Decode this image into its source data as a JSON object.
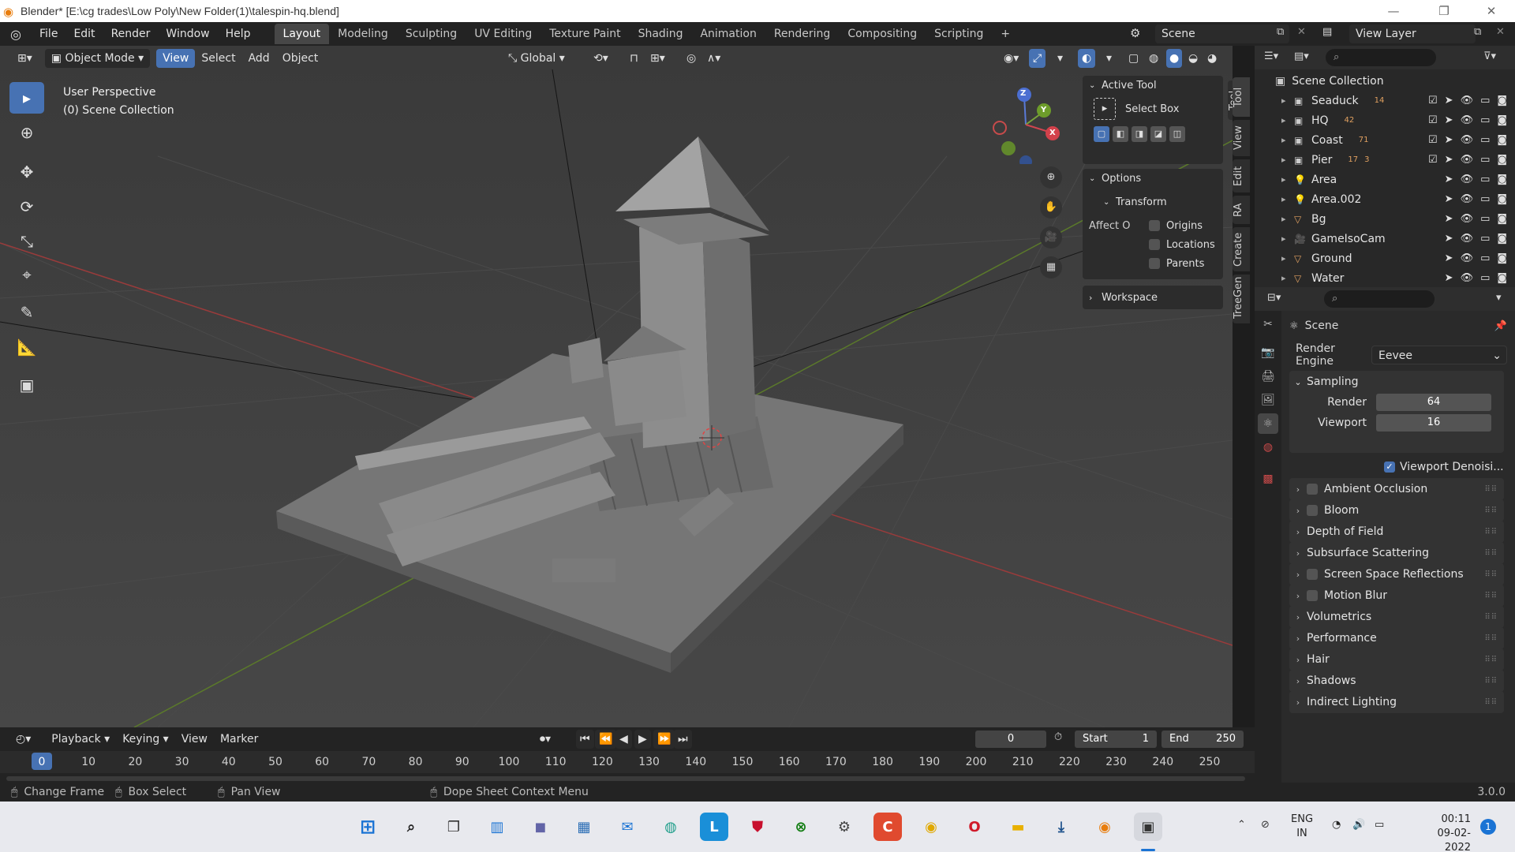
{
  "window": {
    "title": "Blender* [E:\\cg trades\\Low Poly\\New Folder(1)\\talespin-hq.blend]",
    "controls": [
      "—",
      "❐",
      "✕"
    ]
  },
  "menu": {
    "items": [
      "File",
      "Edit",
      "Render",
      "Window",
      "Help"
    ],
    "workspaces": [
      "Layout",
      "Modeling",
      "Sculpting",
      "UV Editing",
      "Texture Paint",
      "Shading",
      "Animation",
      "Rendering",
      "Compositing",
      "Scripting"
    ],
    "active_workspace": "Layout",
    "add_tab": "+",
    "scene": "Scene",
    "view_layer": "View Layer"
  },
  "viewport": {
    "mode": "Object Mode",
    "menus": [
      "View",
      "Select",
      "Add",
      "Object"
    ],
    "orientation": "Global",
    "info_line1": "User Perspective",
    "info_line2": "(0) Scene Collection",
    "gizmo": {
      "z": "Z",
      "y": "Y",
      "x": "X"
    }
  },
  "npanel": {
    "active_tool_title": "Active Tool",
    "tool_name": "Select Box",
    "options_title": "Options",
    "transform_title": "Transform",
    "affect_label": "Affect O",
    "affect_options": [
      {
        "label": "Origins",
        "checked": false
      },
      {
        "label": "Locations",
        "checked": false
      },
      {
        "label": "Parents",
        "checked": false
      }
    ],
    "workspace_title": "Workspace",
    "tabs": [
      "Tool",
      "View",
      "Edit",
      "RA",
      "Create",
      "TreeGen"
    ]
  },
  "outliner": {
    "root": "Scene Collection",
    "items": [
      {
        "name": "Seaduck",
        "badge": "14",
        "type": "collection"
      },
      {
        "name": "HQ",
        "badge": "42",
        "type": "collection"
      },
      {
        "name": "Coast",
        "badge": "71",
        "type": "collection"
      },
      {
        "name": "Pier",
        "badge": "17",
        "badge2": "3",
        "type": "collection"
      },
      {
        "name": "Area",
        "badge": "",
        "type": "light"
      },
      {
        "name": "Area.002",
        "badge": "",
        "type": "light"
      },
      {
        "name": "Bg",
        "badge": "",
        "type": "mesh"
      },
      {
        "name": "GameIsoCam",
        "badge": "",
        "type": "camera"
      },
      {
        "name": "Ground",
        "badge": "",
        "type": "mesh"
      },
      {
        "name": "Water",
        "badge": "",
        "type": "mesh"
      }
    ]
  },
  "properties": {
    "context": "Scene",
    "render_engine_label": "Render Engine",
    "render_engine": "Eevee",
    "sampling_title": "Sampling",
    "render_label": "Render",
    "render_value": "64",
    "viewport_label": "Viewport",
    "viewport_value": "16",
    "denoise_label": "Viewport Denoisi...",
    "panels": [
      {
        "label": "Ambient Occlusion",
        "checkbox": true
      },
      {
        "label": "Bloom",
        "checkbox": true
      },
      {
        "label": "Depth of Field",
        "checkbox": false
      },
      {
        "label": "Subsurface Scattering",
        "checkbox": false
      },
      {
        "label": "Screen Space Reflections",
        "checkbox": true
      },
      {
        "label": "Motion Blur",
        "checkbox": true
      },
      {
        "label": "Volumetrics",
        "checkbox": false
      },
      {
        "label": "Performance",
        "checkbox": false
      },
      {
        "label": "Hair",
        "checkbox": false
      },
      {
        "label": "Shadows",
        "checkbox": false
      },
      {
        "label": "Indirect Lighting",
        "checkbox": false
      }
    ]
  },
  "timeline": {
    "menus": [
      "Playback",
      "Keying",
      "View",
      "Marker"
    ],
    "current_frame": "0",
    "start_label": "Start",
    "start": "1",
    "end_label": "End",
    "end": "250",
    "ticks": [
      "0",
      "10",
      "20",
      "30",
      "40",
      "50",
      "60",
      "70",
      "80",
      "90",
      "100",
      "110",
      "120",
      "130",
      "140",
      "150",
      "160",
      "170",
      "180",
      "190",
      "200",
      "210",
      "220",
      "230",
      "240",
      "250"
    ]
  },
  "statusbar": {
    "hints": [
      "Change Frame",
      "Box Select",
      "Pan View",
      "Dope Sheet Context Menu"
    ],
    "version": "3.0.0"
  },
  "taskbar": {
    "lang1": "ENG",
    "lang2": "IN",
    "time": "00:11",
    "date": "09-02-2022",
    "notifications": "1"
  },
  "colors": {
    "accent": "#4772b3",
    "viewport_bg": "#3d3d3d",
    "panel_bg": "#2a2a2a"
  }
}
